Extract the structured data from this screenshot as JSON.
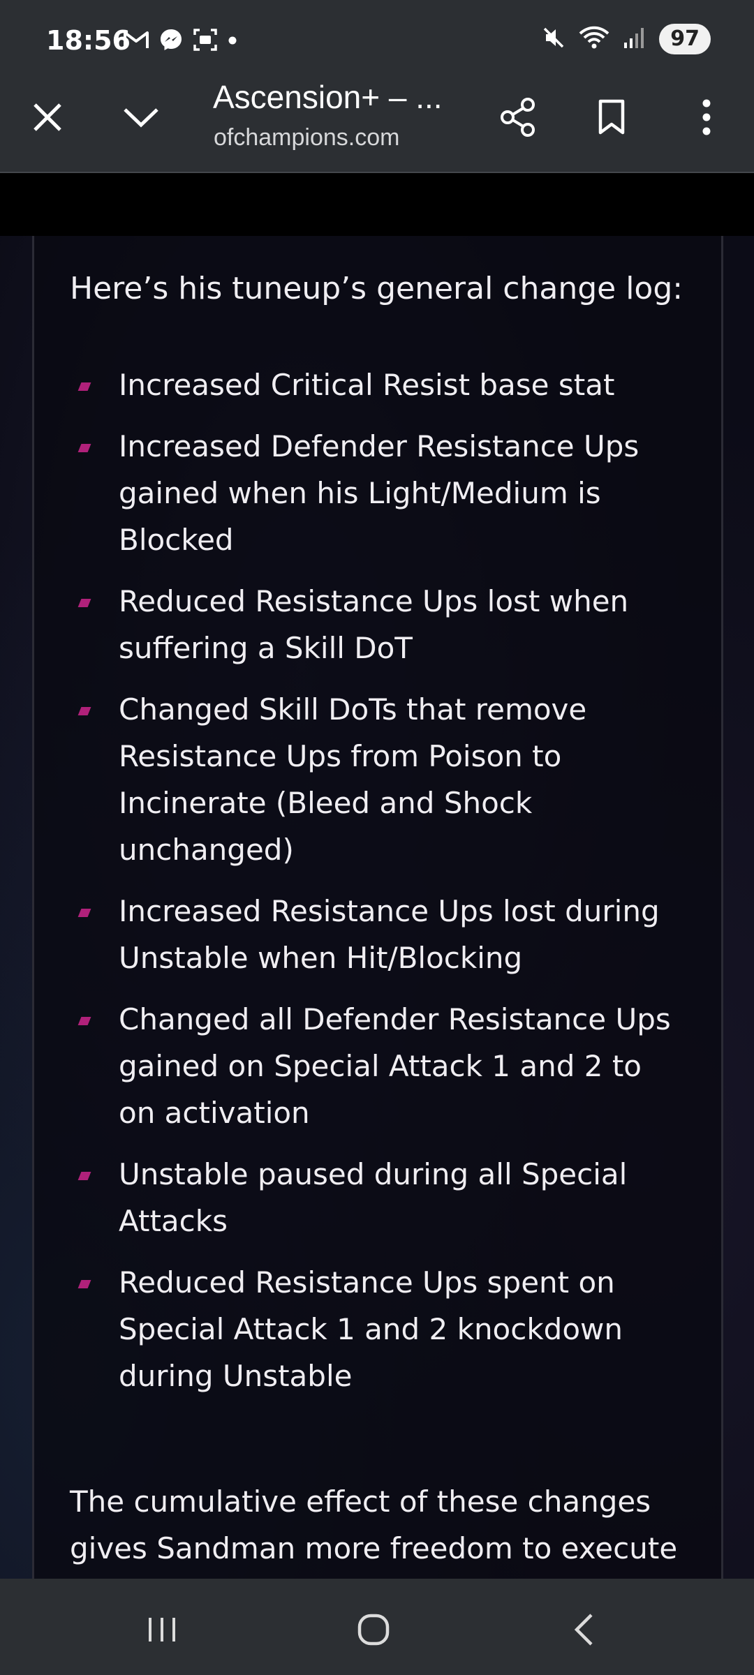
{
  "status_bar": {
    "time": "18:56",
    "battery": "97"
  },
  "toolbar": {
    "title": "Ascension+ – ...",
    "url": "ofchampions.com"
  },
  "article": {
    "intro": "Here’s his tuneup’s general change log:",
    "changes": [
      "Increased Critical Resist base stat",
      "Increased Defender Resistance Ups gained when his Light/Medium is Blocked",
      "Reduced Resistance Ups lost when suffering a Skill DoT",
      "Changed Skill DoTs that remove Resistance Ups from Poison to Incinerate (Bleed and Shock unchanged)",
      "Increased Resistance Ups lost during Unstable when Hit/Blocking",
      "Changed all Defender Resistance Ups gained on Special Attack 1 and 2 to on activation",
      "Unstable paused during all Special Attacks",
      "Reduced Resistance Ups spent on Special Attack 1 and 2 knockdown during Unstable"
    ],
    "outro": "The cumulative effect of these changes gives Sandman more freedom to execute"
  },
  "colors": {
    "bullet": "#b0217a",
    "chrome": "#2c2f33",
    "text": "#f0eef2"
  },
  "icons": {
    "status_left": [
      "gmail-icon",
      "messenger-icon",
      "screenshot-icon",
      "dot-icon"
    ],
    "status_right": [
      "mute-icon",
      "wifi-icon",
      "signal-icon"
    ],
    "toolbar": [
      "close-icon",
      "chevron-down-icon",
      "share-icon",
      "bookmark-icon",
      "more-vert-icon"
    ],
    "nav": [
      "recents-icon",
      "home-icon",
      "back-icon"
    ]
  }
}
